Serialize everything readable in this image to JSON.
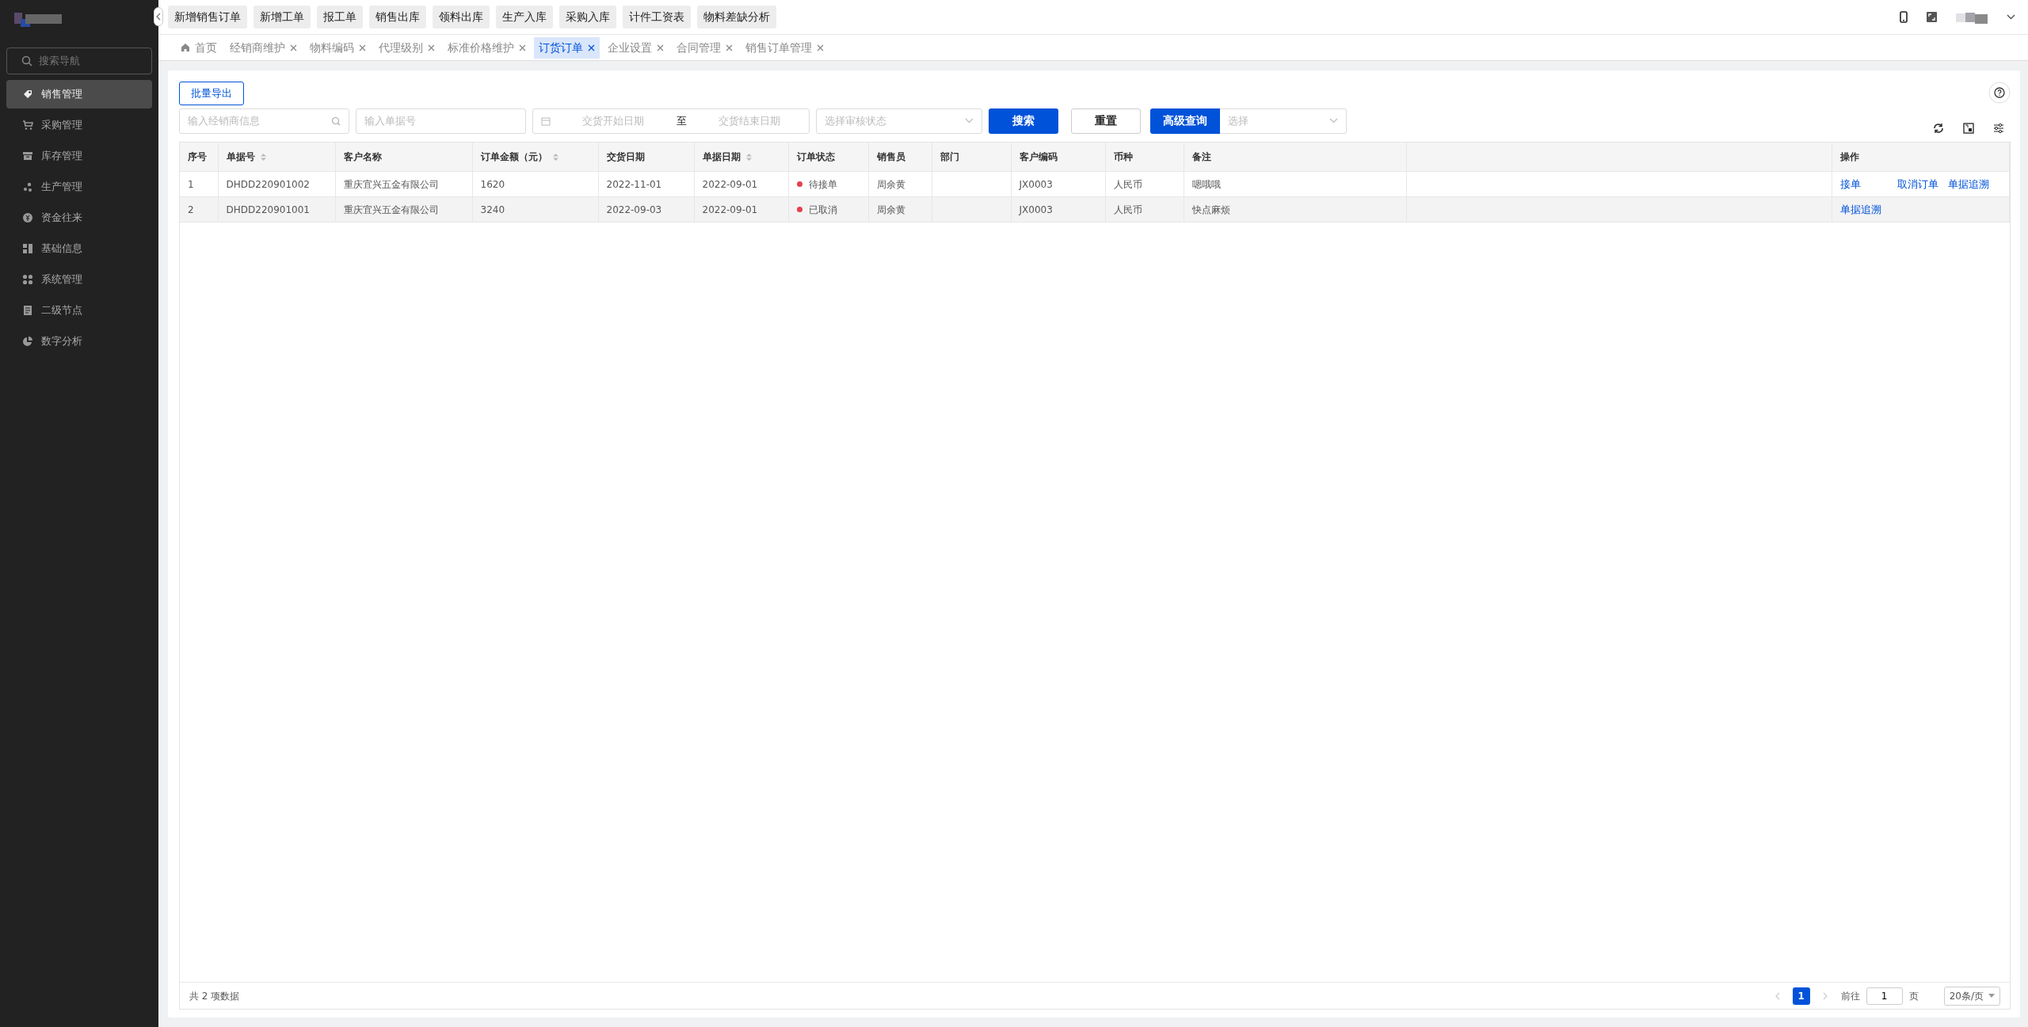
{
  "shortcuts": [
    {
      "label": "新增销售订单"
    },
    {
      "label": "新增工单"
    },
    {
      "label": "报工单"
    },
    {
      "label": "销售出库"
    },
    {
      "label": "领料出库"
    },
    {
      "label": "生产入库"
    },
    {
      "label": "采购入库"
    },
    {
      "label": "计件工资表"
    },
    {
      "label": "物料差缺分析"
    }
  ],
  "nav_search": {
    "placeholder": "搜索导航"
  },
  "menu": [
    {
      "label": "销售管理",
      "selected": true
    },
    {
      "label": "采购管理",
      "selected": false
    },
    {
      "label": "库存管理",
      "selected": false
    },
    {
      "label": "生产管理",
      "selected": false
    },
    {
      "label": "资金往来",
      "selected": false
    },
    {
      "label": "基础信息",
      "selected": false
    },
    {
      "label": "系统管理",
      "selected": false
    },
    {
      "label": "二级节点",
      "selected": false
    },
    {
      "label": "数字分析",
      "selected": false
    }
  ],
  "tabs": [
    {
      "label": "首页",
      "kind": "home",
      "selected": false
    },
    {
      "label": "经销商维护",
      "kind": "page",
      "selected": false
    },
    {
      "label": "物料编码",
      "kind": "page",
      "selected": false
    },
    {
      "label": "代理级别",
      "kind": "page",
      "selected": false
    },
    {
      "label": "标准价格维护",
      "kind": "page",
      "selected": false
    },
    {
      "label": "订货订单",
      "kind": "page",
      "selected": true
    },
    {
      "label": "企业设置",
      "kind": "page",
      "selected": false
    },
    {
      "label": "合同管理",
      "kind": "page",
      "selected": false
    },
    {
      "label": "销售订单管理",
      "kind": "page",
      "selected": false
    }
  ],
  "export_button": "批量导出",
  "filters": {
    "dealer": {
      "placeholder": "输入经销商信息"
    },
    "order_no": {
      "placeholder": "输入单据号"
    },
    "date_start": {
      "placeholder": "交货开始日期"
    },
    "date_separator": "至",
    "date_end": {
      "placeholder": "交货结束日期"
    },
    "status": {
      "placeholder": "选择审核状态"
    },
    "search_button": "搜索",
    "reset_button": "重置",
    "advanced_button": "高级查询",
    "advanced_select": {
      "placeholder": "选择"
    }
  },
  "table": {
    "columns": [
      {
        "label": "序号",
        "sortable": false
      },
      {
        "label": "单据号",
        "sortable": true
      },
      {
        "label": "客户名称",
        "sortable": false
      },
      {
        "label": "订单金额（元）",
        "sortable": true
      },
      {
        "label": "交货日期",
        "sortable": false
      },
      {
        "label": "单据日期",
        "sortable": true
      },
      {
        "label": "订单状态",
        "sortable": false
      },
      {
        "label": "销售员",
        "sortable": false
      },
      {
        "label": "部门",
        "sortable": false
      },
      {
        "label": "客户编码",
        "sortable": false
      },
      {
        "label": "币种",
        "sortable": false
      },
      {
        "label": "备注",
        "sortable": false
      },
      {
        "label": "操作",
        "sortable": false
      }
    ],
    "rows": [
      {
        "selected": false,
        "index": "1",
        "order_no": "DHDD220901002",
        "customer": "重庆宜兴五金有限公司",
        "amount": "1620",
        "delivery_date": "2022-11-01",
        "doc_date": "2022-09-01",
        "status": {
          "label": "待接单",
          "color": "#e5404f"
        },
        "salesperson": "周余黄",
        "customer_code": "JX0003",
        "currency": "人民币",
        "remark": "嗯哦哦",
        "actions": [
          "接单",
          "取消订单",
          "单据追溯"
        ]
      },
      {
        "selected": true,
        "index": "2",
        "order_no": "DHDD220901001",
        "customer": "重庆宜兴五金有限公司",
        "amount": "3240",
        "delivery_date": "2022-09-03",
        "doc_date": "2022-09-01",
        "status": {
          "label": "已取消",
          "color": "#e5404f"
        },
        "salesperson": "周余黄",
        "customer_code": "JX0003",
        "currency": "人民币",
        "remark": "快点麻烦",
        "actions": [
          "单据追溯"
        ]
      }
    ]
  },
  "pagination": {
    "total": "共 2 项数据",
    "pages": [
      {
        "label": "1",
        "selected": true
      }
    ],
    "goto_label": "前往",
    "goto_value": "1",
    "page_unit": "页",
    "page_size": "20条/页"
  }
}
